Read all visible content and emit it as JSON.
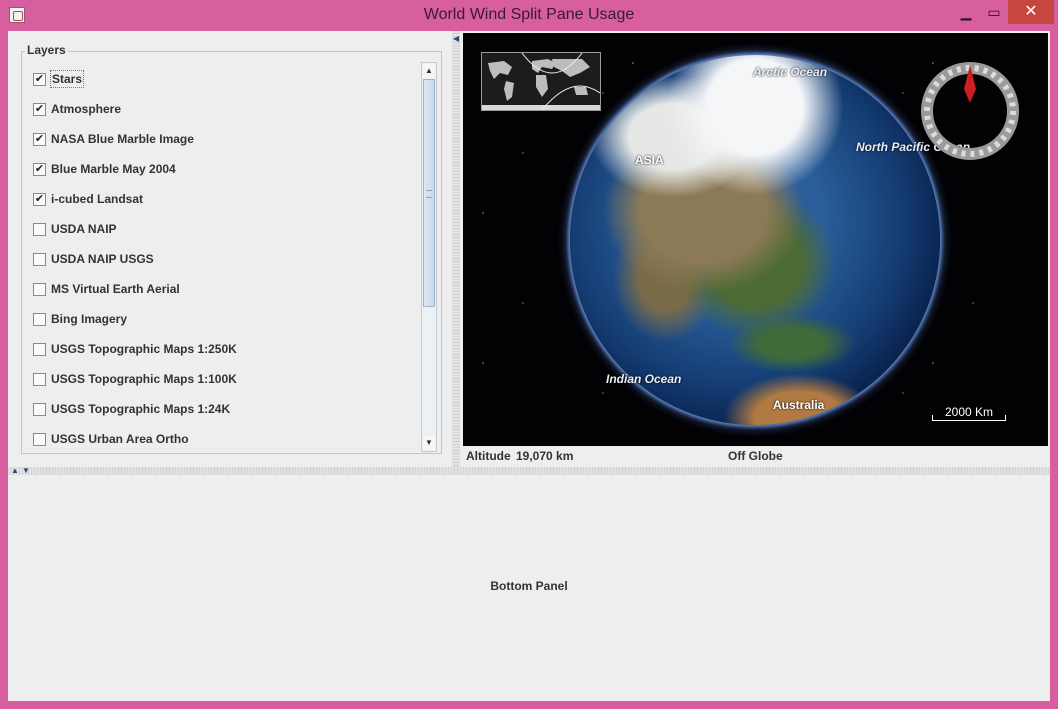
{
  "window": {
    "title": "World Wind Split Pane Usage",
    "minimize": "▁",
    "maximize": "▭",
    "close": "✕"
  },
  "layers": {
    "legend": "Layers",
    "items": [
      {
        "label": "Stars",
        "checked": true
      },
      {
        "label": "Atmosphere",
        "checked": true
      },
      {
        "label": "NASA Blue Marble Image",
        "checked": true
      },
      {
        "label": "Blue Marble May 2004",
        "checked": true
      },
      {
        "label": "i-cubed Landsat",
        "checked": true
      },
      {
        "label": "USDA NAIP",
        "checked": false
      },
      {
        "label": "USDA NAIP USGS",
        "checked": false
      },
      {
        "label": "MS Virtual Earth Aerial",
        "checked": false
      },
      {
        "label": "Bing Imagery",
        "checked": false
      },
      {
        "label": "USGS Topographic Maps 1:250K",
        "checked": false
      },
      {
        "label": "USGS Topographic Maps 1:100K",
        "checked": false
      },
      {
        "label": "USGS Topographic Maps 1:24K",
        "checked": false
      },
      {
        "label": "USGS Urban Area Ortho",
        "checked": false
      }
    ],
    "scroll_up": "▲",
    "scroll_down": "▼"
  },
  "globe": {
    "labels": {
      "arctic": "Arctic Ocean",
      "asia": "ASIA",
      "pacific": "North Pacific Ocean",
      "indian": "Indian Ocean",
      "australia": "Australia"
    },
    "scale": "2000 Km",
    "compass_color": "#cc1f1f"
  },
  "status": {
    "altitude_label": "Altitude",
    "altitude_value": "19,070 km",
    "position": "Off Globe"
  },
  "dividers": {
    "left_arrow": "◀",
    "up_arrow": "▲",
    "down_arrow": "▼"
  },
  "bottom": {
    "label": "Bottom Panel"
  },
  "colors": {
    "frame": "#d75fa0",
    "close_button": "#c7463f"
  }
}
